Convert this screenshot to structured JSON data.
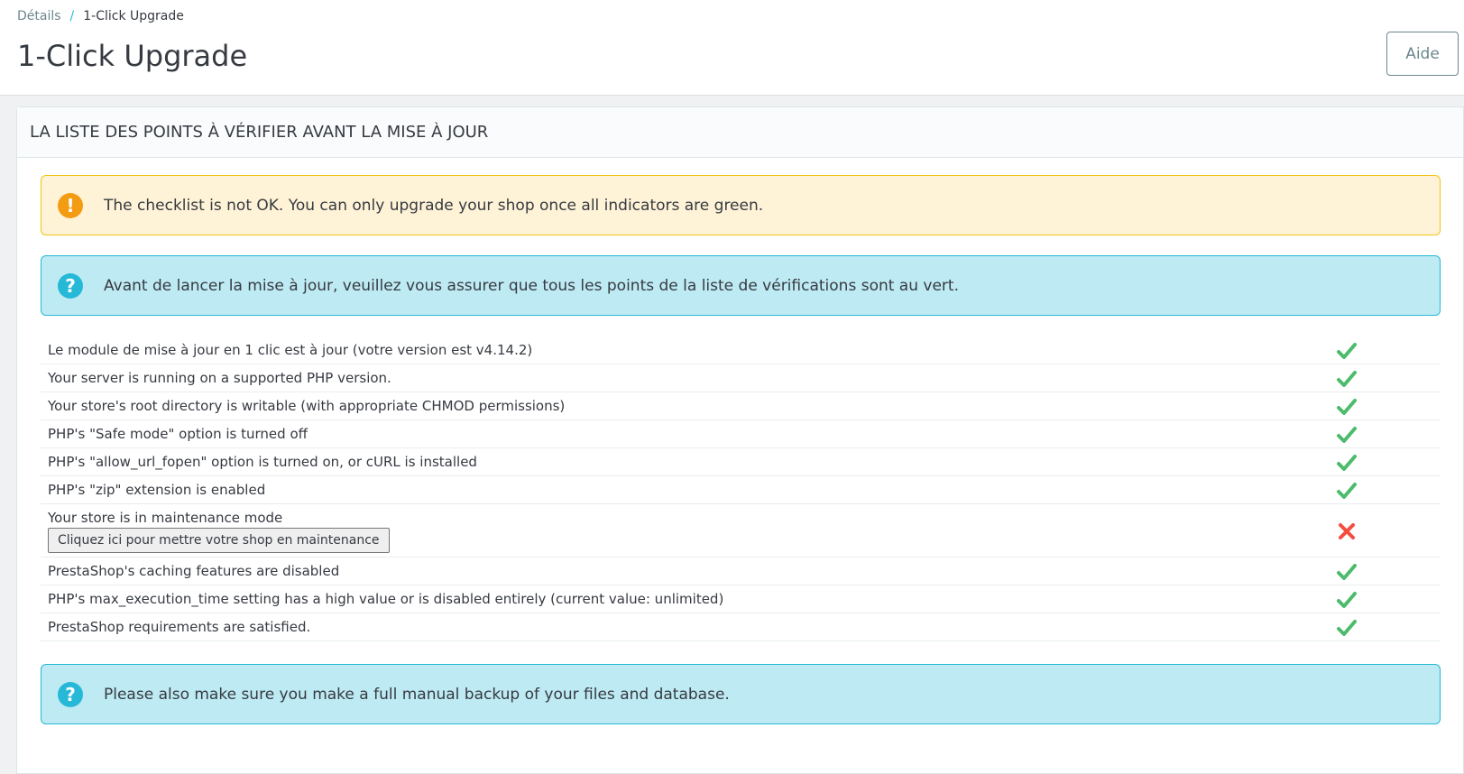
{
  "breadcrumb": {
    "parent": "Détails",
    "separator": "/",
    "current": "1-Click Upgrade"
  },
  "page": {
    "title": "1-Click Upgrade",
    "help_label": "Aide"
  },
  "panel": {
    "heading": "LA LISTE DES POINTS À VÉRIFIER AVANT LA MISE À JOUR"
  },
  "alerts": {
    "warning_icon": "!",
    "info_icon": "?",
    "warning": "The checklist is not OK. You can only upgrade your shop once all indicators are green.",
    "info_top": "Avant de lancer la mise à jour, veuillez vous assurer que tous les points de la liste de vérifications sont au vert.",
    "info_bottom": "Please also make sure you make a full manual backup of your files and database."
  },
  "checklist": [
    {
      "label": "Le module de mise à jour en 1 clic est à jour (votre version est v4.14.2)",
      "status": "ok"
    },
    {
      "label": "Your server is running on a supported PHP version.",
      "status": "ok"
    },
    {
      "label": "Your store's root directory is writable (with appropriate CHMOD permissions)",
      "status": "ok"
    },
    {
      "label": "PHP's \"Safe mode\" option is turned off",
      "status": "ok"
    },
    {
      "label": "PHP's \"allow_url_fopen\" option is turned on, or cURL is installed",
      "status": "ok"
    },
    {
      "label": "PHP's \"zip\" extension is enabled",
      "status": "ok"
    },
    {
      "label": "Your store is in maintenance mode",
      "status": "fail",
      "button": "Cliquez ici pour mettre votre shop en maintenance"
    },
    {
      "label": "PrestaShop's caching features are disabled",
      "status": "ok"
    },
    {
      "label": "PHP's max_execution_time setting has a high value or is disabled entirely (current value: unlimited)",
      "status": "ok"
    },
    {
      "label": "PrestaShop requirements are satisfied.",
      "status": "ok"
    }
  ],
  "colors": {
    "ok": "#4cbb6c",
    "fail": "#f54c3e",
    "warning": "#f39c12",
    "info": "#25b9d7"
  }
}
